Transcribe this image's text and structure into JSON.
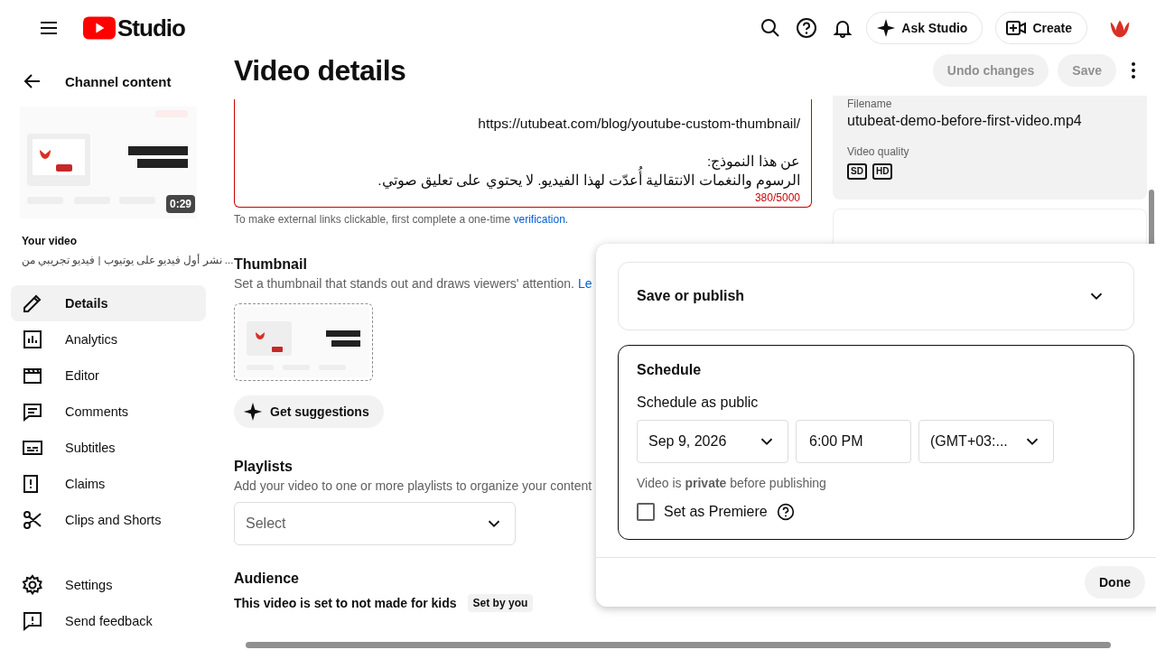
{
  "header": {
    "logo_text": "Studio",
    "ask_button": "Ask Studio",
    "create_button": "Create"
  },
  "sidebar": {
    "back_title": "Channel content",
    "thumbnail": {
      "kind": "picture",
      "duration": "0:29"
    },
    "your_video_label": "Your video",
    "video_title": "... نشر أول فيديو على يوتيوب | فيديو تجريبي من",
    "items": [
      {
        "label": "Details",
        "selected": true
      },
      {
        "label": "Analytics",
        "selected": false
      },
      {
        "label": "Editor",
        "selected": false
      },
      {
        "label": "Comments",
        "selected": false
      },
      {
        "label": "Subtitles",
        "selected": false
      },
      {
        "label": "Claims",
        "selected": false
      },
      {
        "label": "Clips and Shorts",
        "selected": false
      }
    ],
    "bottom_items": [
      {
        "label": "Settings"
      },
      {
        "label": "Send feedback"
      }
    ]
  },
  "page": {
    "title": "Video details",
    "undo_button": {
      "label": "Undo changes",
      "disabled": true
    },
    "save_button": {
      "label": "Save",
      "disabled": true
    }
  },
  "description": {
    "paragraphs": [
      [
        "/https://utubeat.com/blog/youtube-custom-thumbnail"
      ],
      [
        "عن هذا النموذج:",
        "الرسوم والنغمات الانتقالية أُعدّت لهذا الفيديو. لا يحتوي على تعليق صوتي."
      ]
    ],
    "counter": "380/5000",
    "hint": "To make external links clickable, first complete a one-time",
    "hint_link": "verification",
    "hint_end": "."
  },
  "thumbnail_section": {
    "heading": "Thumbnail",
    "text": "Set a thumbnail that stands out and draws viewers' attention.",
    "link": "Le",
    "button": "Get suggestions"
  },
  "playlists": {
    "heading": "Playlists",
    "text": "Add your video to one or more playlists to organize your content",
    "placeholder": "Select"
  },
  "audience": {
    "heading": "Audience",
    "text": "This video is set to not made for kids",
    "chip": "Set by you"
  },
  "info_panel": {
    "filename_label": "Filename",
    "filename": "utubeat-demo-before-first-video.mp4",
    "quality_label": "Video quality",
    "qualities": [
      "SD",
      "HD"
    ]
  },
  "publish_dialog": {
    "save_or_publish": {
      "label": "Save or publish",
      "expanded": false
    },
    "schedule": {
      "heading": "Schedule",
      "subheading": "Schedule as public",
      "date": "Sep 9, 2026",
      "time": "6:00 PM",
      "timezone": "(GMT+03:...",
      "note": "Video is **private** before publishing",
      "premiere": {
        "label": "Set as Premiere",
        "checked": false
      }
    },
    "done_button": "Done"
  }
}
